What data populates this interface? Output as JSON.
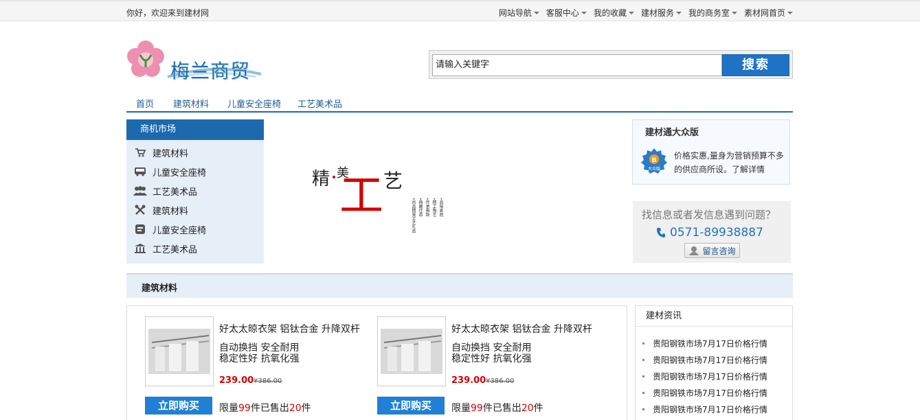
{
  "topbar": {
    "welcome": "你好，欢迎来到建材网",
    "nav": [
      "网站导航",
      "客服中心",
      "我的收藏",
      "建材服务",
      "我的商务室",
      "素材网首页"
    ]
  },
  "logo": {
    "text": "梅兰商贸"
  },
  "search": {
    "value": "请输入关键字",
    "button": "搜索"
  },
  "mainnav": [
    "首页",
    "建筑材料",
    "儿童安全座椅",
    "工艺美术品"
  ],
  "sidebar": {
    "title": "商机市场",
    "items": [
      {
        "label": "建筑材料",
        "icon": "cart-icon"
      },
      {
        "label": "儿童安全座椅",
        "icon": "bus-icon"
      },
      {
        "label": "工艺美术品",
        "icon": "users-icon"
      },
      {
        "label": "建筑材料",
        "icon": "tools-icon"
      },
      {
        "label": "儿童安全座椅",
        "icon": "blog-icon"
      },
      {
        "label": "工艺美术品",
        "icon": "bank-icon"
      }
    ]
  },
  "banner": {
    "t1": "精",
    "t2": "美",
    "big": "工",
    "t3": "艺",
    "cols": [
      "•品味家居",
      "•精工陶艺",
      "•传承雅致",
      "•典藏佳品",
      "•尚品精美工艺礼品"
    ]
  },
  "promo": {
    "title": "建材通大众版",
    "badge": "大众版",
    "text": "价格实惠,量身为营销预算不多的供应商所设。了解详情"
  },
  "contact": {
    "question": "找信息或者发信息遇到问题？",
    "phone": "0571-89938887",
    "button": "留言咨询"
  },
  "section": {
    "title": "建筑材料"
  },
  "products": [
    {
      "name": "好太太晾衣架 铝钛合金 升降双杆",
      "feat1": "自动换挡 安全耐用",
      "feat2": "稳定性好 抗氧化强",
      "price": "239.00",
      "old": "¥386.00",
      "buy": "立即购买",
      "limit_pre": "限量",
      "limit_n": "99",
      "limit_mid": "件已售出",
      "sold": "20",
      "limit_post": "件"
    },
    {
      "name": "好太太晾衣架 铝钛合金 升降双杆",
      "feat1": "自动换挡 安全耐用",
      "feat2": "稳定性好 抗氧化强",
      "price": "239.00",
      "old": "¥386.00",
      "buy": "立即购买",
      "limit_pre": "限量",
      "limit_n": "99",
      "limit_mid": "件已售出",
      "sold": "20",
      "limit_post": "件"
    }
  ],
  "news": {
    "title": "建材资讯",
    "items": [
      "贵阳钢铁市场7月17日价格行情",
      "贵阳钢铁市场7月17日价格行情",
      "贵阳钢铁市场7月17日价格行情",
      "贵阳钢铁市场7月17日价格行情",
      "贵阳钢铁市场7月17日价格行情"
    ]
  },
  "colors": {
    "brand": "#1c6aad",
    "accent": "#1f73c5",
    "price": "#d40000"
  }
}
